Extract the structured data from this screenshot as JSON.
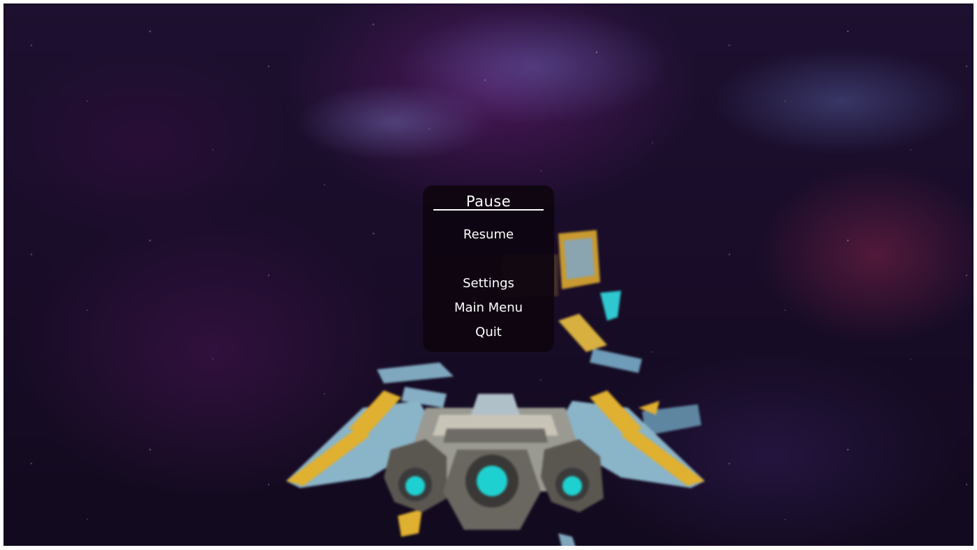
{
  "pause_menu": {
    "title": "Pause",
    "buttons": {
      "resume": "Resume",
      "settings": "Settings",
      "main_menu": "Main Menu",
      "quit": "Quit"
    }
  },
  "scene": {
    "background": "blurred purple nebula space scene",
    "player_ship": "spaceship-rear-view",
    "colors": {
      "panel_bg": "#0e0510",
      "text": "#ffffff",
      "ship_body": "#8ab4c8",
      "ship_accent": "#e0b030",
      "engine_glow": "#1fd0d0"
    }
  }
}
